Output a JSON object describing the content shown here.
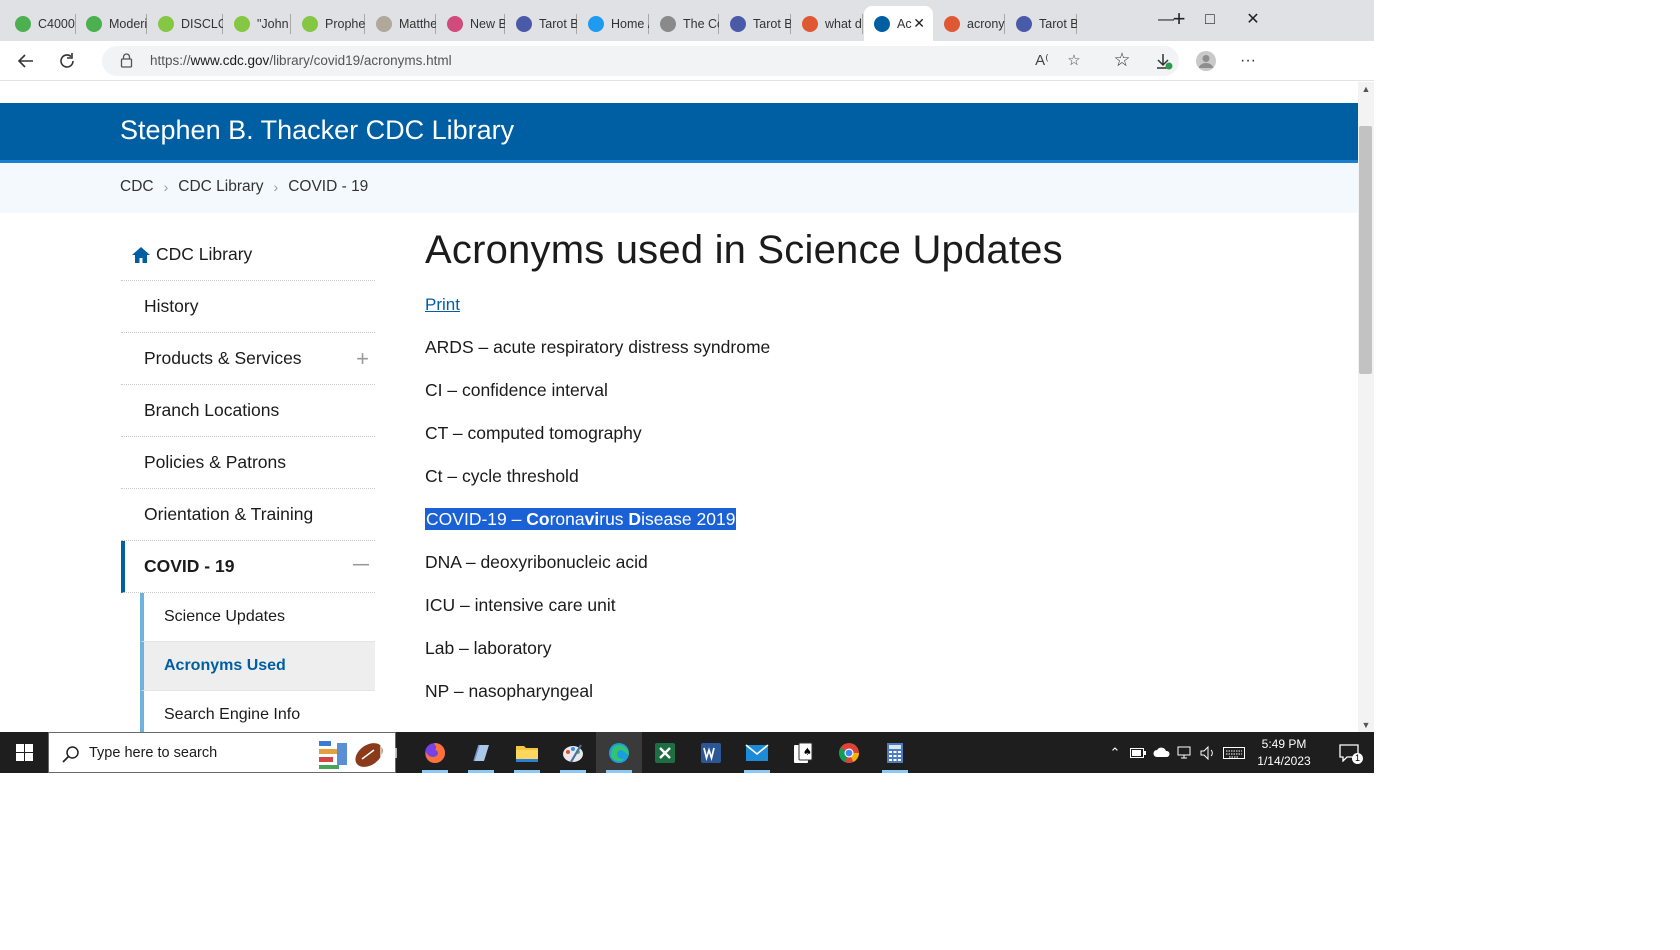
{
  "browser": {
    "tabs": [
      {
        "label": "C4000",
        "icon": "green-swirl-icon",
        "color": "#4caf50"
      },
      {
        "label": "Moderi",
        "icon": "green-swirl-icon",
        "color": "#4caf50"
      },
      {
        "label": "DISCLO",
        "icon": "rumble-play-icon",
        "color": "#85c742"
      },
      {
        "label": "\"John M",
        "icon": "rumble-play-icon",
        "color": "#85c742"
      },
      {
        "label": "Prophe",
        "icon": "rumble-play-icon",
        "color": "#85c742"
      },
      {
        "label": "Matthe",
        "icon": "image-thumb-icon",
        "color": "#b0a89a"
      },
      {
        "label": "New Bi",
        "icon": "gem-icon",
        "color": "#d04a7a"
      },
      {
        "label": "Tarot B",
        "icon": "moon-icon",
        "color": "#4b5aa8"
      },
      {
        "label": "Home /",
        "icon": "twitter-bird-icon",
        "color": "#1d9bf0"
      },
      {
        "label": "The Co",
        "icon": "cube-icon",
        "color": "#8a8a8a"
      },
      {
        "label": "Tarot B",
        "icon": "moon-icon",
        "color": "#4b5aa8"
      },
      {
        "label": "what d",
        "icon": "duckduckgo-icon",
        "color": "#de5833"
      },
      {
        "label": "Ac",
        "icon": "cdc-logo-icon",
        "color": "#005ea2",
        "active": true
      },
      {
        "label": "acrony",
        "icon": "duckduckgo-icon",
        "color": "#de5833"
      },
      {
        "label": "Tarot B",
        "icon": "moon-icon",
        "color": "#4b5aa8"
      }
    ],
    "new_tab_label": "+",
    "url_prefix": "https://",
    "url_host": "www.cdc.gov",
    "url_path": "/library/covid19/acronyms.html"
  },
  "site": {
    "title": "Stephen B. Thacker CDC Library",
    "breadcrumbs": [
      "CDC",
      "CDC Library",
      "COVID - 19"
    ],
    "brand_color": "#005ea2"
  },
  "nav": {
    "home_label": "CDC Library",
    "items": [
      {
        "label": "History"
      },
      {
        "label": "Products & Services",
        "expander": "+"
      },
      {
        "label": "Branch Locations"
      },
      {
        "label": "Policies & Patrons"
      },
      {
        "label": "Orientation & Training"
      },
      {
        "label": "COVID - 19",
        "expander": "—"
      }
    ],
    "sub_items": [
      {
        "label": "Science Updates"
      },
      {
        "label": "Acronyms Used"
      },
      {
        "label": "Search Engine Info"
      }
    ]
  },
  "main": {
    "title": "Acronyms used in Science Updates",
    "print_label": "Print",
    "acronyms": [
      "ARDS – acute respiratory distress syndrome",
      "CI – confidence interval",
      "CT – computed tomography",
      "Ct – cycle threshold",
      "COVID-19 – Coronavirus Disease 2019",
      "DNA – deoxyribonucleic acid",
      "ICU – intensive care unit",
      "Lab – laboratory",
      "NP – nasopharyngeal"
    ],
    "selected_index": 4
  },
  "taskbar": {
    "search_placeholder": "Type here to search",
    "time": "5:49 PM",
    "date": "1/14/2023",
    "notification_count": "1"
  }
}
